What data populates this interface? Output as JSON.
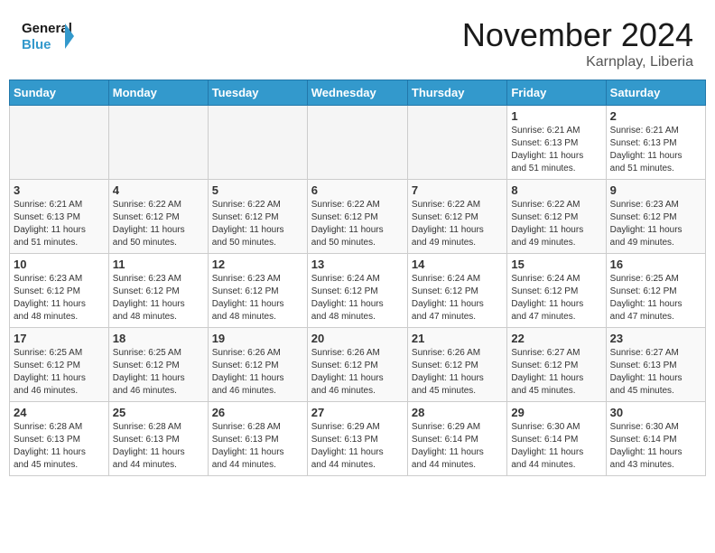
{
  "header": {
    "logo_line1": "General",
    "logo_line2": "Blue",
    "month": "November 2024",
    "location": "Karnplay, Liberia"
  },
  "weekdays": [
    "Sunday",
    "Monday",
    "Tuesday",
    "Wednesday",
    "Thursday",
    "Friday",
    "Saturday"
  ],
  "weeks": [
    [
      {
        "day": "",
        "info": ""
      },
      {
        "day": "",
        "info": ""
      },
      {
        "day": "",
        "info": ""
      },
      {
        "day": "",
        "info": ""
      },
      {
        "day": "",
        "info": ""
      },
      {
        "day": "1",
        "info": "Sunrise: 6:21 AM\nSunset: 6:13 PM\nDaylight: 11 hours\nand 51 minutes."
      },
      {
        "day": "2",
        "info": "Sunrise: 6:21 AM\nSunset: 6:13 PM\nDaylight: 11 hours\nand 51 minutes."
      }
    ],
    [
      {
        "day": "3",
        "info": "Sunrise: 6:21 AM\nSunset: 6:13 PM\nDaylight: 11 hours\nand 51 minutes."
      },
      {
        "day": "4",
        "info": "Sunrise: 6:22 AM\nSunset: 6:12 PM\nDaylight: 11 hours\nand 50 minutes."
      },
      {
        "day": "5",
        "info": "Sunrise: 6:22 AM\nSunset: 6:12 PM\nDaylight: 11 hours\nand 50 minutes."
      },
      {
        "day": "6",
        "info": "Sunrise: 6:22 AM\nSunset: 6:12 PM\nDaylight: 11 hours\nand 50 minutes."
      },
      {
        "day": "7",
        "info": "Sunrise: 6:22 AM\nSunset: 6:12 PM\nDaylight: 11 hours\nand 49 minutes."
      },
      {
        "day": "8",
        "info": "Sunrise: 6:22 AM\nSunset: 6:12 PM\nDaylight: 11 hours\nand 49 minutes."
      },
      {
        "day": "9",
        "info": "Sunrise: 6:23 AM\nSunset: 6:12 PM\nDaylight: 11 hours\nand 49 minutes."
      }
    ],
    [
      {
        "day": "10",
        "info": "Sunrise: 6:23 AM\nSunset: 6:12 PM\nDaylight: 11 hours\nand 48 minutes."
      },
      {
        "day": "11",
        "info": "Sunrise: 6:23 AM\nSunset: 6:12 PM\nDaylight: 11 hours\nand 48 minutes."
      },
      {
        "day": "12",
        "info": "Sunrise: 6:23 AM\nSunset: 6:12 PM\nDaylight: 11 hours\nand 48 minutes."
      },
      {
        "day": "13",
        "info": "Sunrise: 6:24 AM\nSunset: 6:12 PM\nDaylight: 11 hours\nand 48 minutes."
      },
      {
        "day": "14",
        "info": "Sunrise: 6:24 AM\nSunset: 6:12 PM\nDaylight: 11 hours\nand 47 minutes."
      },
      {
        "day": "15",
        "info": "Sunrise: 6:24 AM\nSunset: 6:12 PM\nDaylight: 11 hours\nand 47 minutes."
      },
      {
        "day": "16",
        "info": "Sunrise: 6:25 AM\nSunset: 6:12 PM\nDaylight: 11 hours\nand 47 minutes."
      }
    ],
    [
      {
        "day": "17",
        "info": "Sunrise: 6:25 AM\nSunset: 6:12 PM\nDaylight: 11 hours\nand 46 minutes."
      },
      {
        "day": "18",
        "info": "Sunrise: 6:25 AM\nSunset: 6:12 PM\nDaylight: 11 hours\nand 46 minutes."
      },
      {
        "day": "19",
        "info": "Sunrise: 6:26 AM\nSunset: 6:12 PM\nDaylight: 11 hours\nand 46 minutes."
      },
      {
        "day": "20",
        "info": "Sunrise: 6:26 AM\nSunset: 6:12 PM\nDaylight: 11 hours\nand 46 minutes."
      },
      {
        "day": "21",
        "info": "Sunrise: 6:26 AM\nSunset: 6:12 PM\nDaylight: 11 hours\nand 45 minutes."
      },
      {
        "day": "22",
        "info": "Sunrise: 6:27 AM\nSunset: 6:12 PM\nDaylight: 11 hours\nand 45 minutes."
      },
      {
        "day": "23",
        "info": "Sunrise: 6:27 AM\nSunset: 6:13 PM\nDaylight: 11 hours\nand 45 minutes."
      }
    ],
    [
      {
        "day": "24",
        "info": "Sunrise: 6:28 AM\nSunset: 6:13 PM\nDaylight: 11 hours\nand 45 minutes."
      },
      {
        "day": "25",
        "info": "Sunrise: 6:28 AM\nSunset: 6:13 PM\nDaylight: 11 hours\nand 44 minutes."
      },
      {
        "day": "26",
        "info": "Sunrise: 6:28 AM\nSunset: 6:13 PM\nDaylight: 11 hours\nand 44 minutes."
      },
      {
        "day": "27",
        "info": "Sunrise: 6:29 AM\nSunset: 6:13 PM\nDaylight: 11 hours\nand 44 minutes."
      },
      {
        "day": "28",
        "info": "Sunrise: 6:29 AM\nSunset: 6:14 PM\nDaylight: 11 hours\nand 44 minutes."
      },
      {
        "day": "29",
        "info": "Sunrise: 6:30 AM\nSunset: 6:14 PM\nDaylight: 11 hours\nand 44 minutes."
      },
      {
        "day": "30",
        "info": "Sunrise: 6:30 AM\nSunset: 6:14 PM\nDaylight: 11 hours\nand 43 minutes."
      }
    ]
  ]
}
